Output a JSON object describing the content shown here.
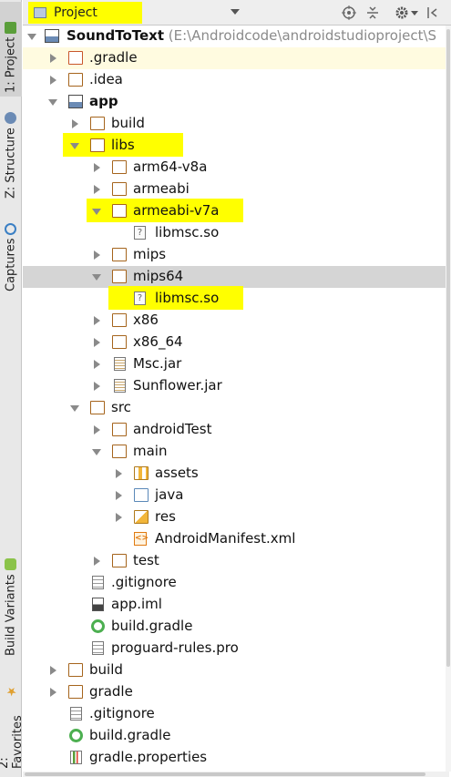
{
  "header": {
    "view_label": "Project",
    "buttons": [
      "target-icon",
      "collapse-all-icon",
      "gear-icon",
      "hide-icon"
    ]
  },
  "left_tabs": [
    {
      "label": "1: Project",
      "icon": "project-icon"
    },
    {
      "label": "Z: Structure",
      "icon": "structure-icon"
    },
    {
      "label": "Captures",
      "icon": "captures-icon"
    },
    {
      "label": "Build Variants",
      "icon": "android-icon"
    },
    {
      "label": "2: Favorites",
      "icon": "star-icon"
    }
  ],
  "tree": {
    "root": {
      "label": "SoundToText",
      "path": " (E:\\Androidcode\\androidstudioproject\\S"
    },
    "items": [
      {
        "label": ".gradle"
      },
      {
        "label": ".idea"
      },
      {
        "label": "app"
      },
      {
        "label": "build"
      },
      {
        "label": "libs"
      },
      {
        "label": "arm64-v8a"
      },
      {
        "label": "armeabi"
      },
      {
        "label": "armeabi-v7a"
      },
      {
        "label": "libmsc.so"
      },
      {
        "label": "mips"
      },
      {
        "label": "mips64"
      },
      {
        "label": "libmsc.so"
      },
      {
        "label": "x86"
      },
      {
        "label": "x86_64"
      },
      {
        "label": "Msc.jar"
      },
      {
        "label": "Sunflower.jar"
      },
      {
        "label": "src"
      },
      {
        "label": "androidTest"
      },
      {
        "label": "main"
      },
      {
        "label": "assets"
      },
      {
        "label": "java"
      },
      {
        "label": "res"
      },
      {
        "label": "AndroidManifest.xml"
      },
      {
        "label": "test"
      },
      {
        "label": ".gitignore"
      },
      {
        "label": "app.iml"
      },
      {
        "label": "build.gradle"
      },
      {
        "label": "proguard-rules.pro"
      },
      {
        "label": "build"
      },
      {
        "label": "gradle"
      },
      {
        "label": ".gitignore"
      },
      {
        "label": "build.gradle"
      },
      {
        "label": "gradle.properties"
      }
    ]
  }
}
